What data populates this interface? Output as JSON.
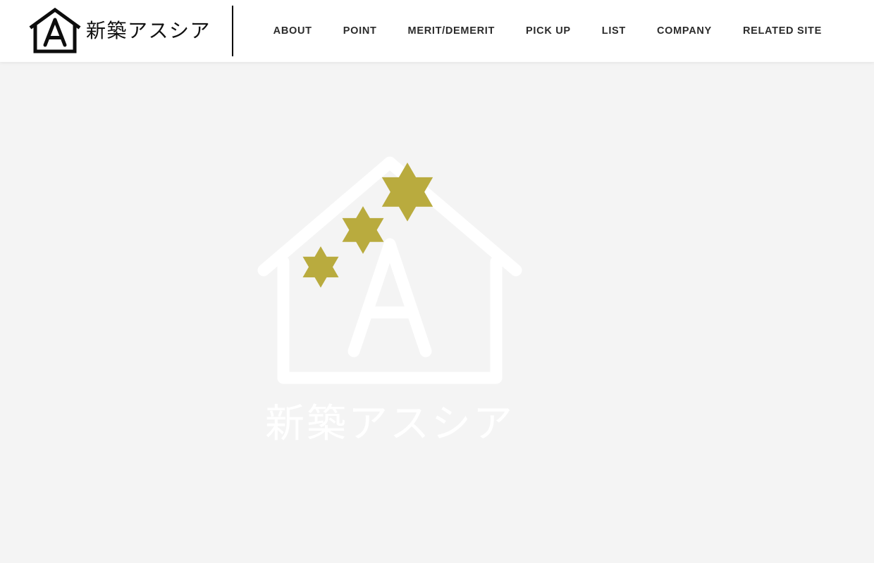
{
  "page": {
    "background_color": "#f4f4f4",
    "header_background_color": "#ffffff",
    "accent_color": "#b9ab3e",
    "watermark_color": "#ffffff",
    "nav_text_color": "#2b2b2b"
  },
  "header": {
    "brand": {
      "logo_icon_name": "house-a-logo-icon",
      "name": "新築アスシア",
      "divider": ""
    },
    "nav": {
      "items": [
        {
          "label": "ABOUT",
          "name": "nav-item-about"
        },
        {
          "label": "POINT",
          "name": "nav-item-point"
        },
        {
          "label": "MERIT/DEMERIT",
          "name": "nav-item-merit-demerit"
        },
        {
          "label": "PICK UP",
          "name": "nav-item-pick-up"
        },
        {
          "label": "LIST",
          "name": "nav-item-list"
        },
        {
          "label": "COMPANY",
          "name": "nav-item-company"
        },
        {
          "label": "RELATED SITE",
          "name": "nav-item-related-site"
        }
      ]
    }
  },
  "splash": {
    "logo_icon_name": "house-a-watermark-icon",
    "watermark_name": "新築アスシア",
    "stars": [
      {
        "name": "star-large",
        "order": 1
      },
      {
        "name": "star-medium",
        "order": 2
      },
      {
        "name": "star-small",
        "order": 3
      }
    ]
  }
}
